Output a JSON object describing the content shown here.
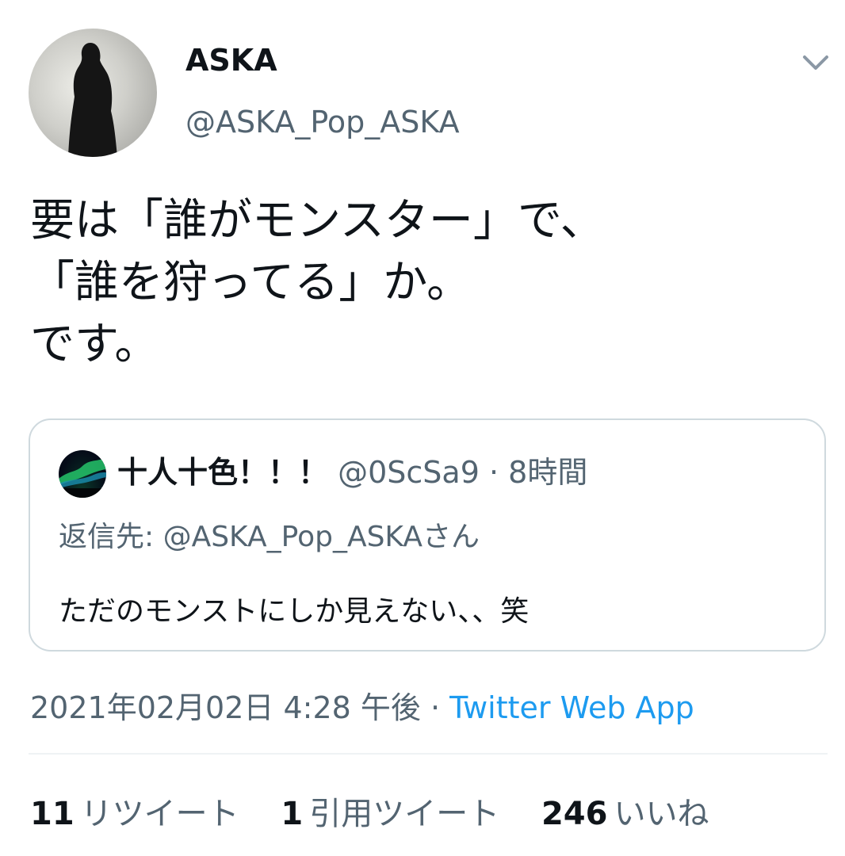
{
  "author": {
    "display_name": "ASKA",
    "handle": "@ASKA_Pop_ASKA"
  },
  "tweet": {
    "lines": [
      "要は「誰がモンスター」で、",
      "「誰を狩ってる」か。",
      "です。"
    ]
  },
  "quoted_tweet": {
    "display_name": "十人十色！！！",
    "handle": "@0ScSa9",
    "separator": " · ",
    "time": "8時間",
    "reply_to": "返信先: @ASKA_Pop_ASKAさん",
    "text": "ただのモンストにしか見えない、、笑"
  },
  "timestamp": {
    "datetime": "2021年02月02日 4:28 午後",
    "separator": " · ",
    "source": "Twitter Web App"
  },
  "stats": {
    "retweets_count": "11",
    "retweets_label": "リツイート",
    "quotes_count": "1",
    "quotes_label": "引用ツイート",
    "likes_count": "246",
    "likes_label": "いいね"
  },
  "colors": {
    "text_primary": "#0f1419",
    "text_secondary": "#536471",
    "link": "#1d9bf0",
    "border": "#cfd9de"
  },
  "icons": {
    "menu": "chevron-down-icon"
  }
}
